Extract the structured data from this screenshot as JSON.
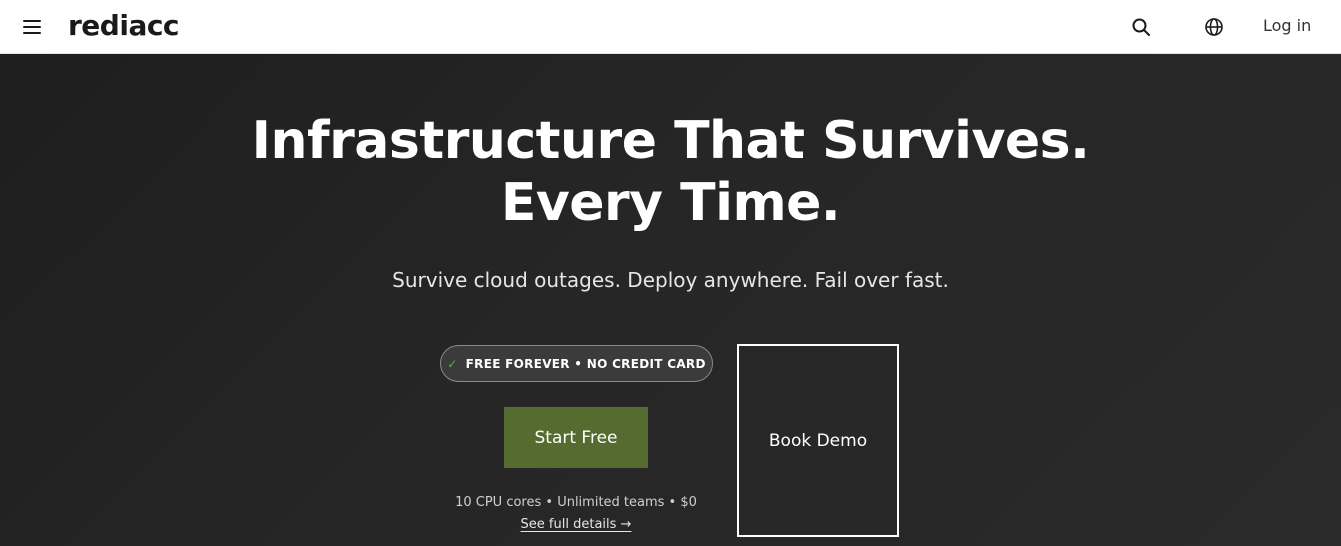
{
  "header": {
    "brand": "rediacc",
    "login_label": "Log in",
    "icons": {
      "menu": "hamburger-menu-icon",
      "search": "search-icon",
      "language": "globe-icon"
    }
  },
  "hero": {
    "title_line1": "Infrastructure That Survives.",
    "title_line2": "Every Time.",
    "subtitle": "Survive cloud outages. Deploy anywhere. Fail over fast.",
    "pill_check": "✓",
    "pill_text": "FREE FOREVER • NO CREDIT CARD",
    "start_label": "Start Free",
    "meta": "10 CPU cores • Unlimited teams • $0",
    "details_link": "See full details →",
    "demo_label": "Book Demo"
  },
  "colors": {
    "background": "#262626",
    "header_bg": "#ffffff",
    "accent_green": "#556b2f",
    "check_green": "#4caf50"
  }
}
